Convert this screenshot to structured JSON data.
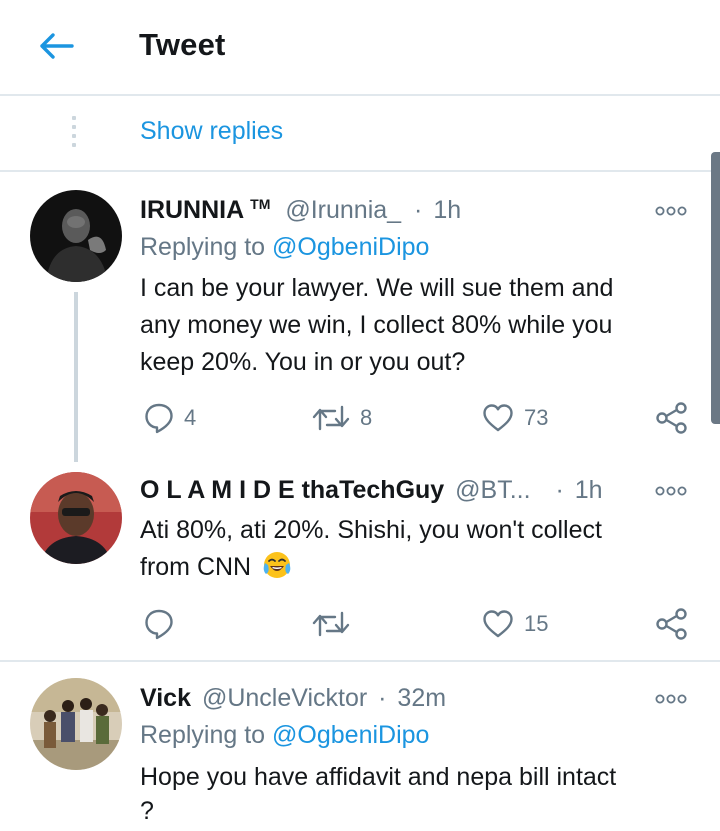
{
  "header": {
    "title": "Tweet",
    "back_icon": "arrow-left-icon"
  },
  "thread": {
    "show_replies": "Show replies"
  },
  "colors": {
    "link": "#1b95e0",
    "secondary": "#657786",
    "divider": "#e1e8ed"
  },
  "tweets": [
    {
      "name": "IRUNNIA",
      "badge": "TM",
      "handle": "@Irunnia_",
      "dot": "·",
      "time": "1h",
      "reply_prefix": "Replying to",
      "reply_to": "@OgbeniDipo",
      "text_lines": [
        "I can be your lawyer. We will sue them and",
        "any money we win, I collect 80% while you",
        "keep 20%. You in or you out?"
      ],
      "replies": "4",
      "retweets": "8",
      "likes": "73"
    },
    {
      "name": "O L A M I D E thaTechGuy",
      "handle": "@BT...",
      "dot": "·",
      "time": "1h",
      "text_lines": [
        "Ati 80%, ati 20%. Shishi, you won't collect",
        "from CNN"
      ],
      "emoji": "face-with-tears-of-joy",
      "replies": "",
      "retweets": "",
      "likes": "15"
    },
    {
      "name": "Vick",
      "handle": "@UncleVicktor",
      "dot": "·",
      "time": "32m",
      "reply_prefix": "Replying to",
      "reply_to": "@OgbeniDipo",
      "text_lines": [
        "Hope you have affidavit and nepa bill intact",
        "?"
      ]
    }
  ]
}
